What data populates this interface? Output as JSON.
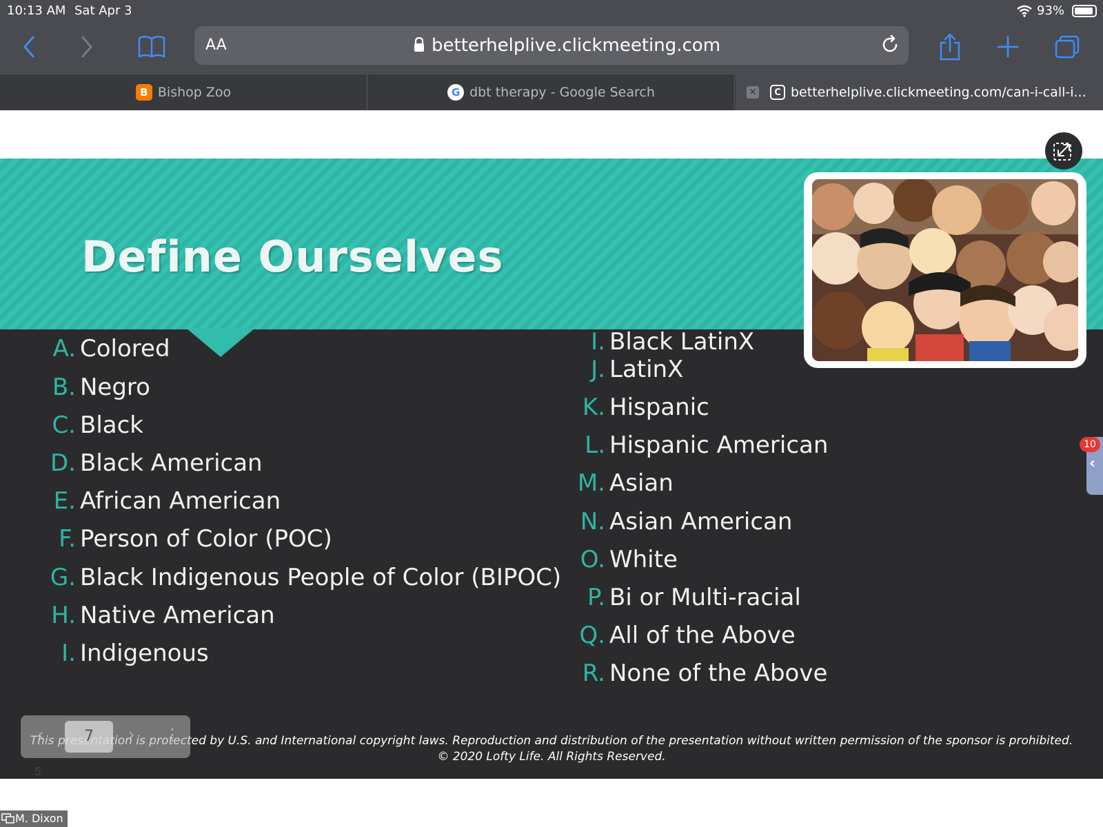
{
  "status": {
    "time": "10:13 AM",
    "date": "Sat Apr 3",
    "battery": "93%",
    "battery_level": 0.93
  },
  "toolbar": {
    "text_size_label": "AA",
    "url": "betterhelplive.clickmeeting.com"
  },
  "tabs": [
    {
      "title": "Bishop Zoo",
      "favicon": "blogger-icon"
    },
    {
      "title": "dbt therapy - Google Search",
      "favicon": "google-icon"
    },
    {
      "title": "betterhelplive.clickmeeting.com/can-i-call-i...",
      "favicon": "clickmeeting-icon"
    }
  ],
  "slide": {
    "title": "Define Ourselves",
    "left_options": [
      {
        "letter": "A.",
        "text": "Colored"
      },
      {
        "letter": "B.",
        "text": "Negro"
      },
      {
        "letter": "C.",
        "text": "Black"
      },
      {
        "letter": "D.",
        "text": "Black American"
      },
      {
        "letter": "E.",
        "text": "African American"
      },
      {
        "letter": "F.",
        "text": "Person of Color (POC)"
      },
      {
        "letter": "G.",
        "text": "Black Indigenous People of Color (BIPOC)"
      },
      {
        "letter": "H.",
        "text": "Native American"
      },
      {
        "letter": "I.",
        "text": "Indigenous"
      }
    ],
    "right_options": [
      {
        "letter": "I.",
        "text": "Black LatinX"
      },
      {
        "letter": "J.",
        "text": "LatinX"
      },
      {
        "letter": "K.",
        "text": "Hispanic"
      },
      {
        "letter": "L.",
        "text": "Hispanic American"
      },
      {
        "letter": "M.",
        "text": "Asian"
      },
      {
        "letter": "N.",
        "text": "Asian American"
      },
      {
        "letter": "O.",
        "text": "White"
      },
      {
        "letter": "P.",
        "text": "Bi or Multi-racial"
      },
      {
        "letter": "Q.",
        "text": "All of the Above"
      },
      {
        "letter": "R.",
        "text": "None of the Above"
      }
    ],
    "copyright_line1": "This presentation is protected by U.S. and International copyright laws. Reproduction and distribution of the presentation without written permission of the sponsor is prohibited.",
    "copyright_line2": "© 2020 Lofty Life. All Rights Reserved."
  },
  "slide_nav": {
    "current_page": "7",
    "small_number": "5"
  },
  "chat": {
    "badge_count": "10"
  },
  "presenter": {
    "name": "M. Dixon"
  },
  "colors": {
    "accent": "#2fb5a5",
    "slide_bg": "#2b2b2d",
    "browser_chrome": "#4a4b50",
    "ios_blue": "#3f8cf5"
  }
}
